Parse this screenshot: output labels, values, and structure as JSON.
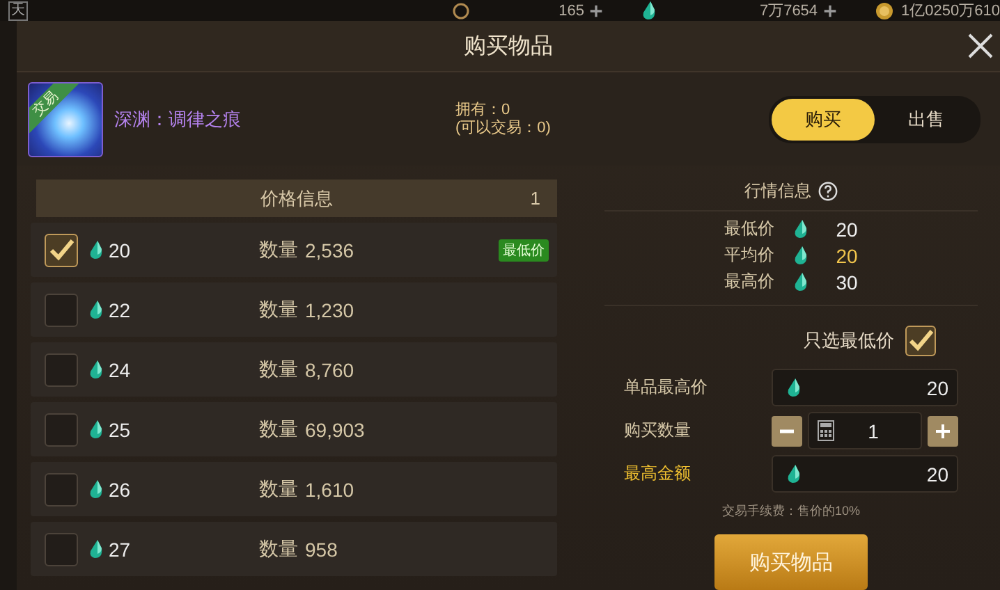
{
  "top_bar": {
    "badge": "天",
    "currencies": [
      {
        "kind": "c",
        "amount": "165",
        "plus": true
      },
      {
        "kind": "gem",
        "amount": "7万7654",
        "plus": true
      },
      {
        "kind": "coin",
        "amount": "1亿0250万610",
        "plus": false
      }
    ]
  },
  "dialog": {
    "title": "购买物品"
  },
  "item": {
    "tag": "交易",
    "name": "深渊：调律之痕",
    "owned": "拥有：0",
    "tradable": "(可以交易：0)"
  },
  "mode_tabs": [
    {
      "label": "购买",
      "selected": true
    },
    {
      "label": "出售",
      "selected": false
    }
  ],
  "price_list": {
    "title": "价格信息",
    "page": "1",
    "rows": [
      {
        "price": "20",
        "quantity_label": "数量",
        "quantity": "2,536",
        "checked": true,
        "badge": "最低价"
      },
      {
        "price": "22",
        "quantity_label": "数量",
        "quantity": "1,230",
        "checked": false
      },
      {
        "price": "24",
        "quantity_label": "数量",
        "quantity": "8,760",
        "checked": false
      },
      {
        "price": "25",
        "quantity_label": "数量",
        "quantity": "69,903",
        "checked": false
      },
      {
        "price": "26",
        "quantity_label": "数量",
        "quantity": "1,610",
        "checked": false
      },
      {
        "price": "27",
        "quantity_label": "数量",
        "quantity": "958",
        "checked": false
      }
    ]
  },
  "market": {
    "title": "行情信息",
    "stats": [
      {
        "label": "最低价",
        "value": "20",
        "highlight": false
      },
      {
        "label": "平均价",
        "value": "20",
        "highlight": true
      },
      {
        "label": "最高价",
        "value": "30",
        "highlight": false
      }
    ]
  },
  "lowest_only": {
    "label": "只选最低价",
    "checked": true
  },
  "fields": [
    {
      "kind": "price",
      "label": "单品最高价",
      "value": "20",
      "highlight": false
    },
    {
      "kind": "stepper",
      "label": "购买数量",
      "value": "1",
      "highlight": false
    },
    {
      "kind": "price",
      "label": "最高金额",
      "value": "20",
      "highlight": true
    }
  ],
  "fee_note": "交易手续费：售价的10%",
  "buy_button": "购买物品"
}
